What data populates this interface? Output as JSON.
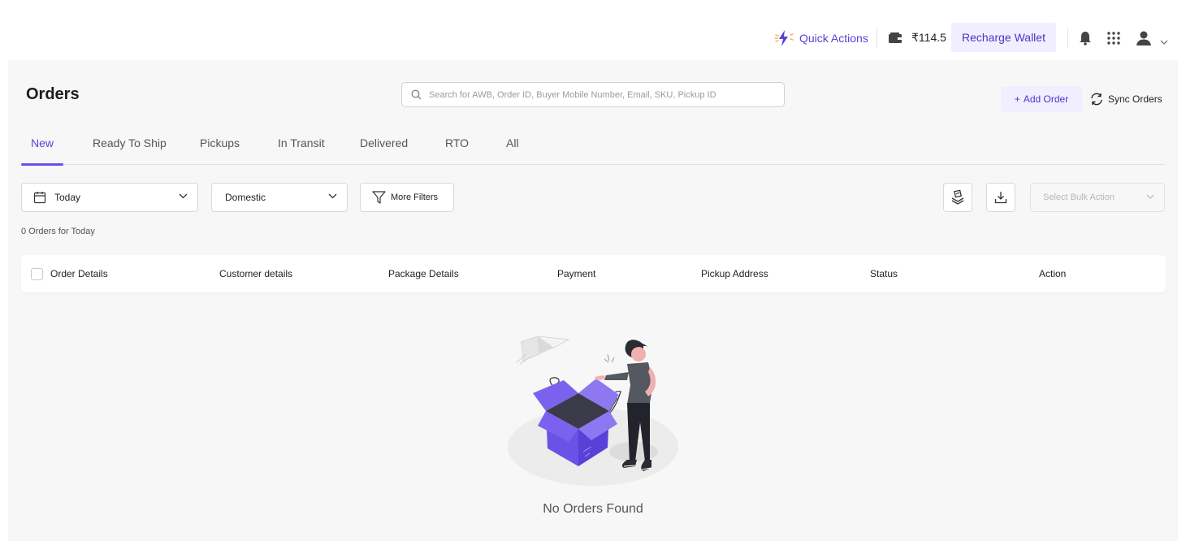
{
  "header": {
    "quick_actions": "Quick Actions",
    "wallet_balance": "₹114.5",
    "recharge_label": "Recharge Wallet",
    "icons": [
      "lightning-icon",
      "wallet-icon",
      "bell-icon",
      "apps-grid-icon",
      "user-icon",
      "chevron-down-icon"
    ]
  },
  "page": {
    "title": "Orders",
    "search_placeholder": "Search for AWB, Order ID, Buyer Mobile Number, Email, SKU, Pickup ID",
    "add_order": "Add Order",
    "add_prefix": "+",
    "sync_orders": "Sync Orders"
  },
  "tabs": [
    {
      "label": "New",
      "active": true
    },
    {
      "label": "Ready To Ship"
    },
    {
      "label": "Pickups"
    },
    {
      "label": "In Transit"
    },
    {
      "label": "Delivered"
    },
    {
      "label": "RTO"
    },
    {
      "label": "All"
    }
  ],
  "filters": {
    "date": "Today",
    "shipment_type": "Domestic",
    "more_filters": "More Filters",
    "bulk_placeholder": "Select Bulk Action"
  },
  "summary": {
    "count_text": "0 Orders for Today"
  },
  "table": {
    "columns": [
      "Order Details",
      "Customer details",
      "Package Details",
      "Payment",
      "Pickup Address",
      "Status",
      "Action"
    ]
  },
  "empty_state": {
    "message": "No Orders Found"
  },
  "colors": {
    "accent": "#5b3fd6",
    "accent_light": "#f1efff",
    "panel_bg": "#f7f7f8"
  }
}
